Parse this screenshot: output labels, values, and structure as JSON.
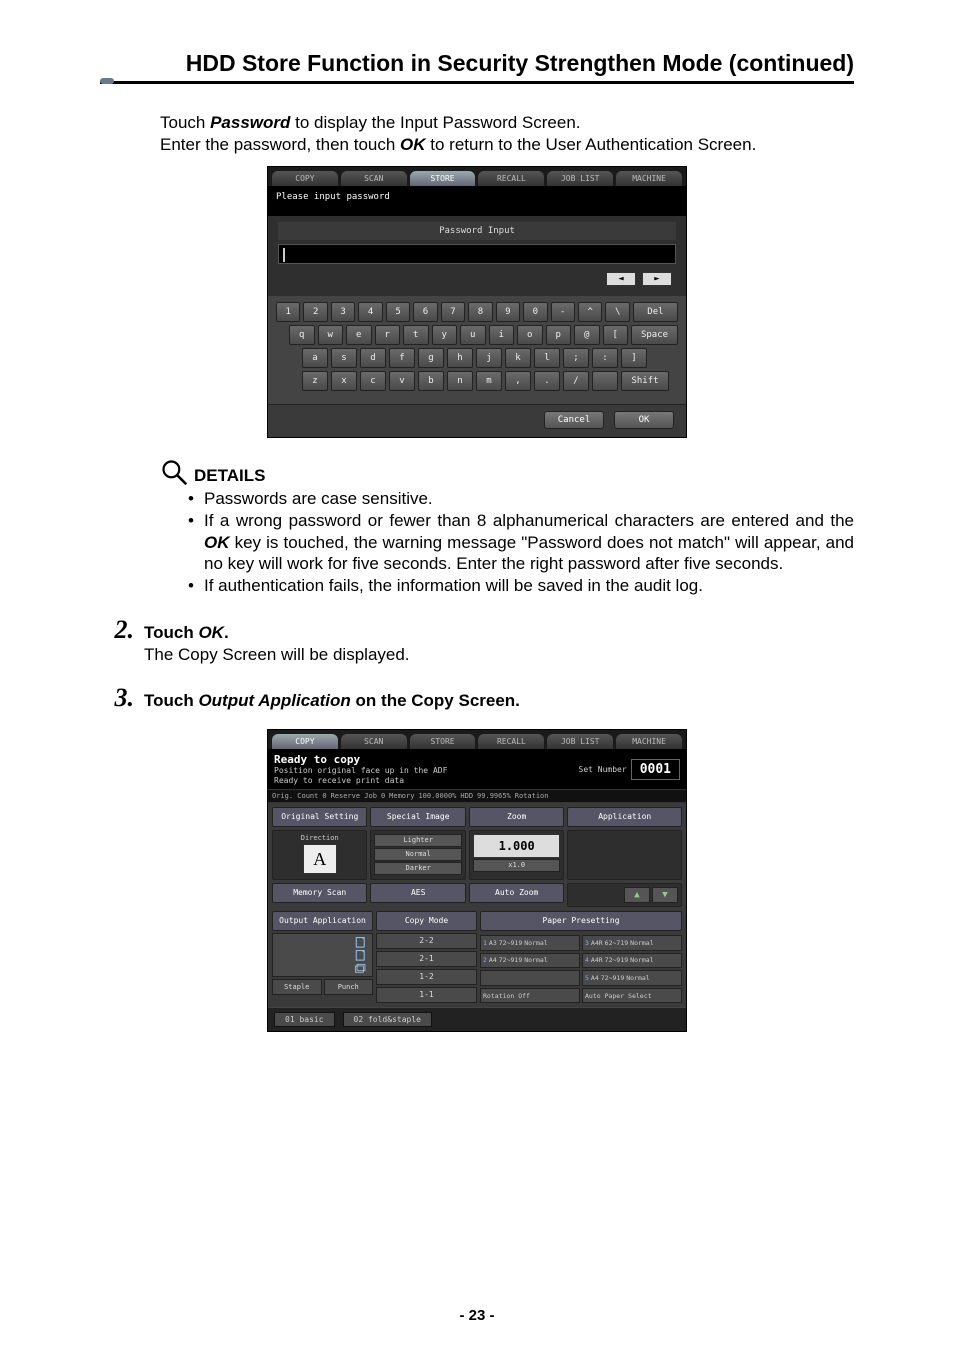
{
  "page": {
    "title": "HDD Store Function in Security Strengthen Mode (continued)",
    "pageNumber": "- 23 -"
  },
  "intro": {
    "line1_a": "Touch ",
    "line1_em": "Password",
    "line1_b": " to display the Input Password Screen.",
    "line2_a": "Enter the password, then touch ",
    "line2_em": "OK",
    "line2_b": " to return to the User Authentication Screen."
  },
  "passwordScreen": {
    "tabs": [
      "COPY",
      "SCAN",
      "STORE",
      "RECALL",
      "JOB LIST",
      "MACHINE"
    ],
    "activeTab": "STORE",
    "message": "Please input password",
    "panelLabel": "Password Input",
    "arrows": {
      "left": "◄",
      "right": "►"
    },
    "rows": [
      [
        "1",
        "2",
        "3",
        "4",
        "5",
        "6",
        "7",
        "8",
        "9",
        "0",
        "-",
        "^",
        "\\",
        "Del"
      ],
      [
        "q",
        "w",
        "e",
        "r",
        "t",
        "y",
        "u",
        "i",
        "o",
        "p",
        "@",
        "[",
        "Space"
      ],
      [
        "a",
        "s",
        "d",
        "f",
        "g",
        "h",
        "j",
        "k",
        "l",
        ";",
        ":",
        "]"
      ],
      [
        "z",
        "x",
        "c",
        "v",
        "b",
        "n",
        "m",
        ",",
        ".",
        "/",
        " ",
        "Shift"
      ]
    ],
    "cancel": "Cancel",
    "ok": "OK"
  },
  "details": {
    "title": "DETAILS",
    "items": [
      "Passwords are case sensitive.",
      {
        "a": "If a wrong password or fewer than 8 alphanumerical characters are entered and the ",
        "em": "OK",
        "b": " key is touched, the warning message \"Password does not match\" will appear, and no key will work for five seconds. Enter the right password after five seconds."
      },
      "If authentication fails, the information will be saved in the audit log."
    ]
  },
  "steps": {
    "s2": {
      "num": "2.",
      "title_a": "Touch ",
      "title_em": "OK",
      "title_b": ".",
      "sub": "The Copy Screen will be displayed."
    },
    "s3": {
      "num": "3.",
      "title_a": "Touch ",
      "title_em": "Output Application",
      "title_b": " on the Copy Screen."
    }
  },
  "copyScreen": {
    "tabs": [
      "COPY",
      "SCAN",
      "STORE",
      "RECALL",
      "JOB LIST",
      "MACHINE"
    ],
    "activeTab": "COPY",
    "ready": "Ready to copy",
    "sub1": "Position original face up in the ADF",
    "sub2": "Ready to receive print data",
    "setNumLabel": "Set Number",
    "setNum": "0001",
    "status": {
      "orig": "Orig. Count",
      "origv": "0",
      "reserve": "Reserve Job",
      "reservev": "0",
      "memory": "Memory",
      "memv": "100.0000%",
      "hdd": "HDD",
      "hddv": "99.9965%",
      "rot": "Rotation"
    },
    "row1": [
      "Original Setting",
      "Special Image",
      "Zoom",
      "Application"
    ],
    "direction": "Direction",
    "letter": "A",
    "density": [
      "Lighter",
      "Normal",
      "Darker"
    ],
    "zoom": "1.000",
    "zoomSmall": "x1.0",
    "row2a": [
      "Memory Scan",
      "AES",
      "Auto Zoom"
    ],
    "arrows": {
      "up": "▲",
      "down": "▼"
    },
    "row3": [
      "Output Application",
      "Copy Mode"
    ],
    "paperHead": "Paper Presetting",
    "copyModes": [
      "2-2",
      "2-1",
      "1-2",
      "1-1"
    ],
    "staple": "Staple",
    "punch": "Punch",
    "paper": [
      {
        "n": "1",
        "sz": "A3",
        "rng": "72~919",
        "mode": "Normal"
      },
      {
        "n": "3",
        "sz": "A4R",
        "rng": "62~719",
        "mode": "Normal"
      },
      {
        "n": "2",
        "sz": "A4",
        "rng": "72~919",
        "mode": "Normal"
      },
      {
        "n": "4",
        "sz": "A4R",
        "rng": "72~919",
        "mode": "Normal"
      },
      {
        "n": "",
        "sz": "",
        "rng": "",
        "mode": ""
      },
      {
        "n": "5",
        "sz": "A4",
        "rng": "72~919",
        "mode": "Normal"
      }
    ],
    "rotation": "Rotation Off",
    "autoPaper": "Auto Paper Select",
    "bottom": [
      "01 basic",
      "02 fold&staple"
    ]
  }
}
